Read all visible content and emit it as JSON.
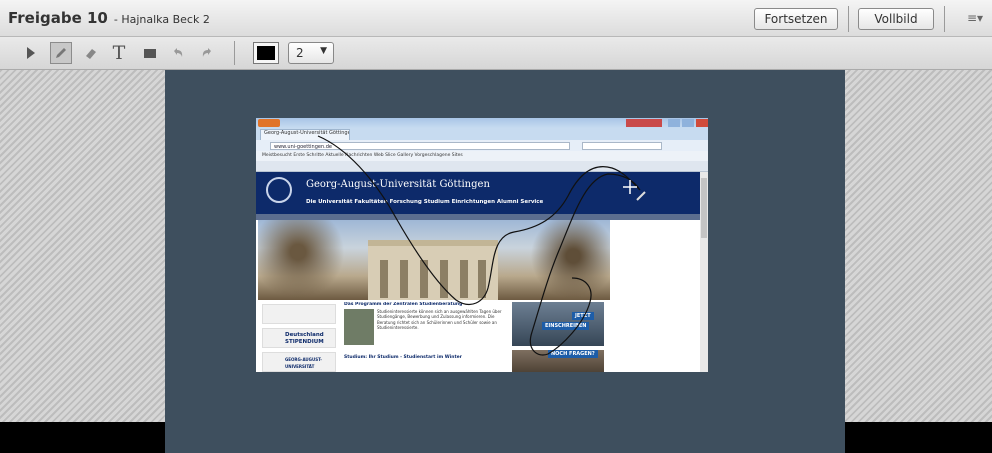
{
  "titlebar": {
    "title": "Freigabe 10",
    "subtitle": "- Hajnalka Beck 2",
    "continue_label": "Fortsetzen",
    "fullscreen_label": "Vollbild",
    "menu_glyph": "≡▾"
  },
  "toolbar": {
    "tools": [
      "arrow-tool",
      "pencil-tool",
      "eraser-tool",
      "text-tool",
      "rectangle-tool",
      "undo-tool",
      "redo-tool"
    ],
    "text_tool_glyph": "T",
    "color": "#000000",
    "size_value": "2",
    "size_arrow": "▼"
  },
  "shared_screen": {
    "browser": {
      "tab_title": "Georg-August-Universität Göttingen",
      "url": "www.uni-goettingen.de",
      "bookmarks": "Meistbesucht   Erste Schritte   Aktuelle Nachrichten   Web Slice Gallery   Vorgeschlagene Sites"
    },
    "page": {
      "title": "Georg-August-Universität Göttingen",
      "nav": "Die Universität   Fakultäten   Forschung   Studium   Einrichtungen   Alumni   Service",
      "card1": "Deutschland STIPENDIUM",
      "card2": "GEORG-AUGUST-UNIVERSITÄT",
      "news_heading": "Das Programm der Zentralen Studienberatung",
      "news_text": "Studieninteressierte können sich an ausgewählten Tagen über Studiengänge, Bewerbung und Zulassung informieren. Die Beratung richtet sich an Schülerinnen und Schüler sowie an Studieninteressierte.",
      "news_heading2": "Studium: Ihr Studium - Studienstart im Winter",
      "badge1": "JETZT",
      "badge2": "EINSCHREIBEN",
      "badge3": "NOCH FRAGEN?"
    }
  },
  "colors": {
    "slate": "#3e4f5e",
    "uni_blue": "#0d2a6a",
    "annotation": "#000000"
  }
}
